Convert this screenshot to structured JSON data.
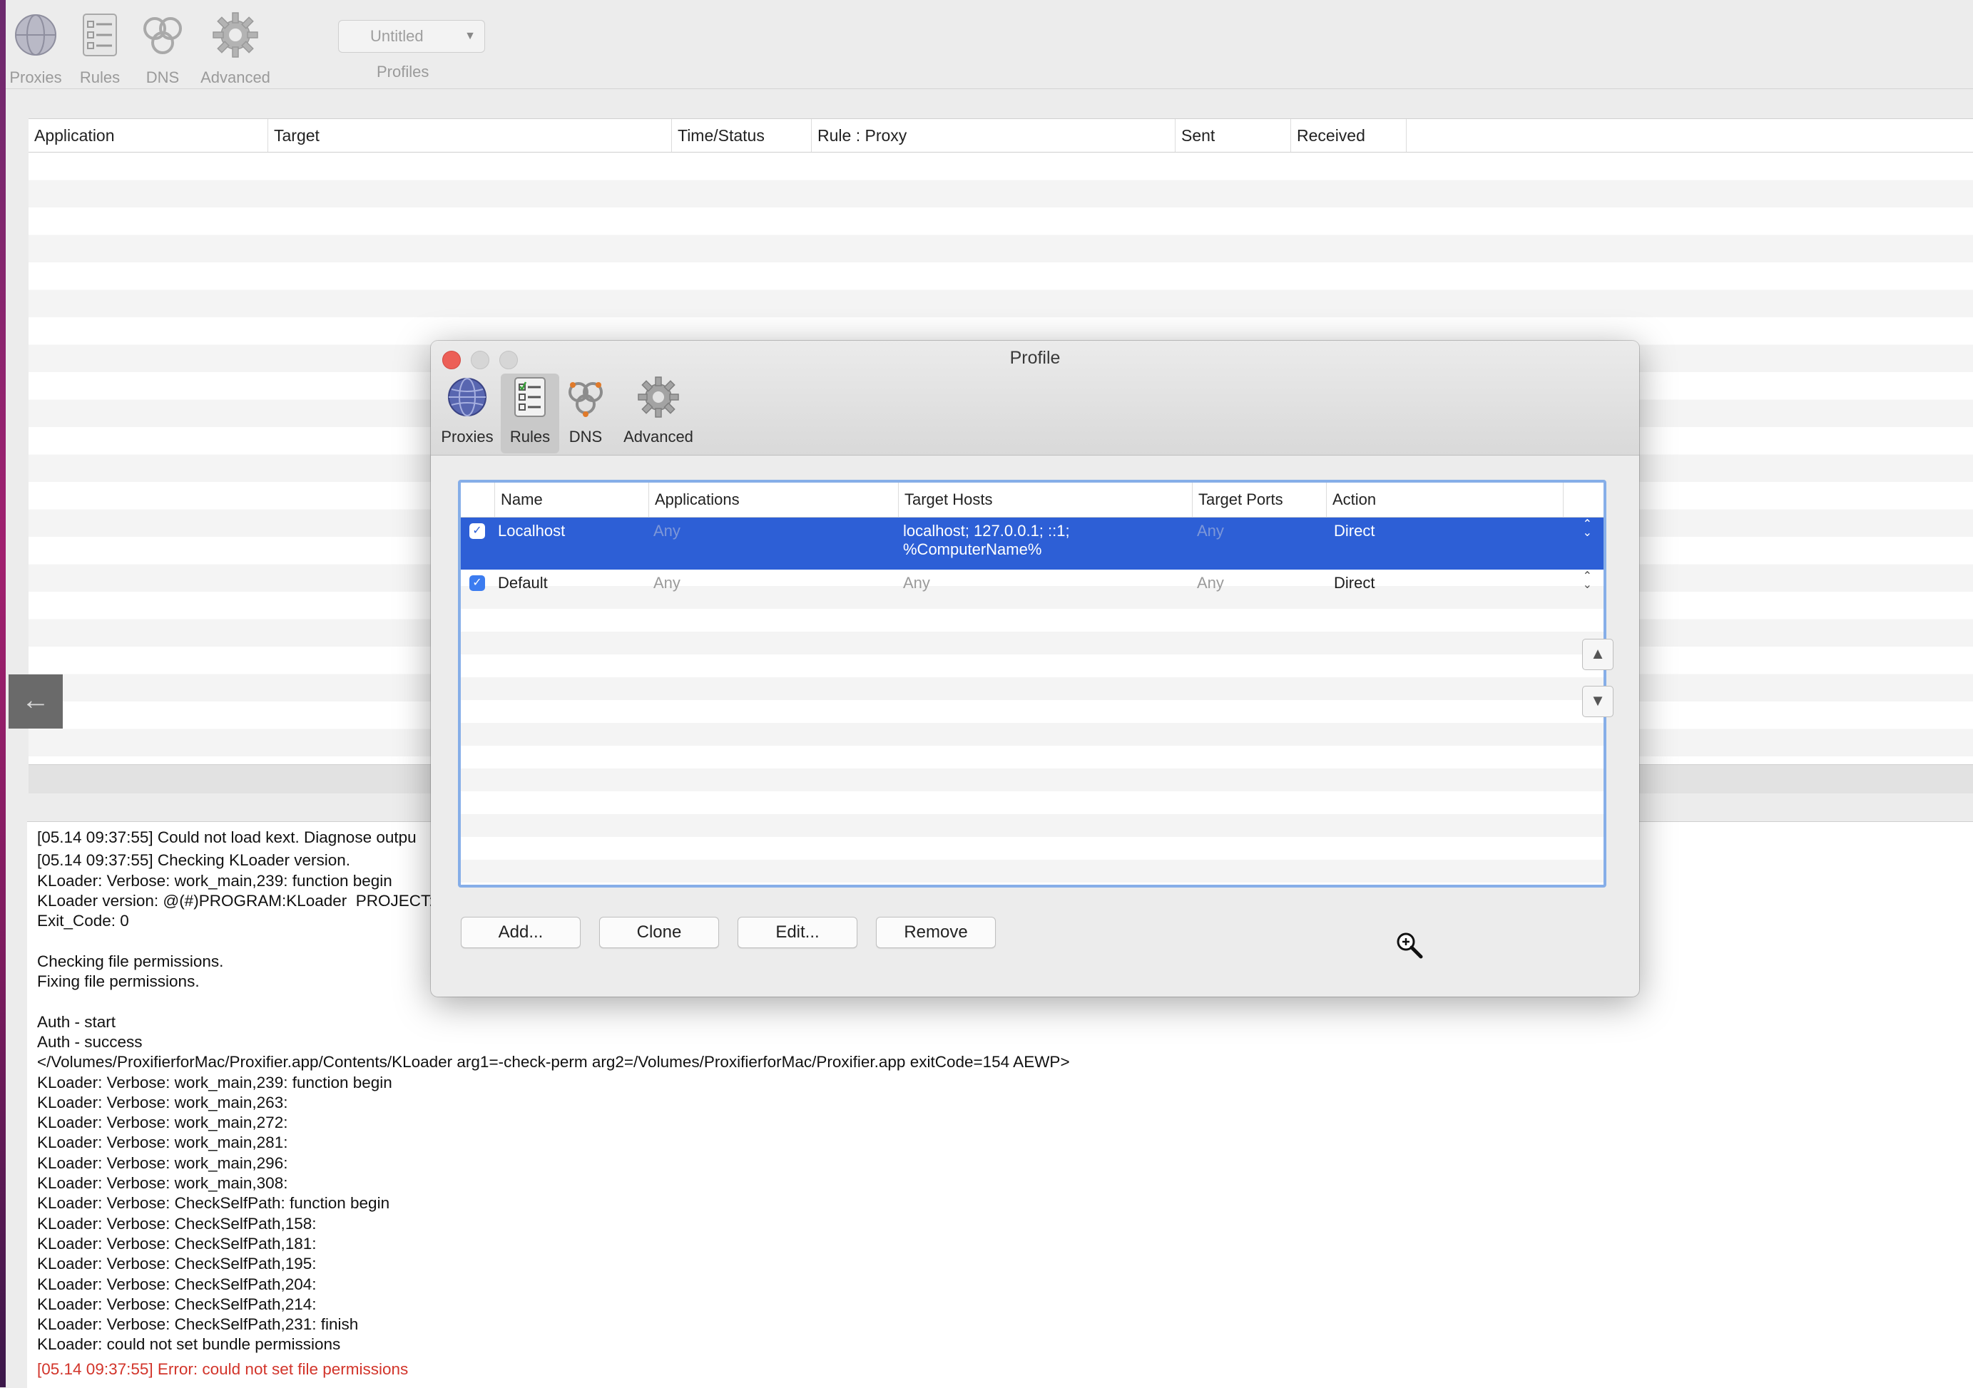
{
  "main_toolbar": {
    "items": [
      {
        "label": "Proxies",
        "icon": "globe-icon"
      },
      {
        "label": "Rules",
        "icon": "rules-list-icon"
      },
      {
        "label": "DNS",
        "icon": "dns-rings-icon"
      },
      {
        "label": "Advanced",
        "icon": "gear-icon"
      }
    ],
    "profile_value": "Untitled",
    "profiles_label": "Profiles"
  },
  "connections": {
    "columns": [
      "Application",
      "Target",
      "Time/Status",
      "Rule : Proxy",
      "Sent",
      "Received"
    ]
  },
  "log": {
    "lines": [
      "[05.14 09:37:55] Could not load kext. Diagnose outpu",
      "[05.14 09:37:55] Checking KLoader version.",
      "KLoader: Verbose: work_main,239: function begin",
      "KLoader version: @(#)PROGRAM:KLoader  PROJECT:",
      "Exit_Code: 0",
      "",
      "Checking file permissions.",
      "Fixing file permissions.",
      "",
      "Auth - start",
      "Auth - success",
      "</Volumes/ProxifierforMac/Proxifier.app/Contents/KLoader arg1=-check-perm arg2=/Volumes/ProxifierforMac/Proxifier.app exitCode=154 AEWP>",
      "KLoader: Verbose: work_main,239: function begin",
      "KLoader: Verbose: work_main,263:",
      "KLoader: Verbose: work_main,272:",
      "KLoader: Verbose: work_main,281:",
      "KLoader: Verbose: work_main,296:",
      "KLoader: Verbose: work_main,308:",
      "KLoader: Verbose: CheckSelfPath: function begin",
      "KLoader: Verbose: CheckSelfPath,158:",
      "KLoader: Verbose: CheckSelfPath,181:",
      "KLoader: Verbose: CheckSelfPath,195:",
      "KLoader: Verbose: CheckSelfPath,204:",
      "KLoader: Verbose: CheckSelfPath,214:",
      "KLoader: Verbose: CheckSelfPath,231: finish",
      "KLoader: could not set bundle permissions"
    ],
    "error_line": "[05.14 09:37:55] Error: could not set file permissions"
  },
  "dialog": {
    "title": "Profile",
    "tabs": [
      {
        "label": "Proxies",
        "icon": "globe-icon"
      },
      {
        "label": "Rules",
        "icon": "rules-list-icon"
      },
      {
        "label": "DNS",
        "icon": "dns-rings-icon"
      },
      {
        "label": "Advanced",
        "icon": "gear-icon"
      }
    ],
    "selected_tab": "Rules",
    "rules_columns": [
      "Name",
      "Applications",
      "Target Hosts",
      "Target Ports",
      "Action"
    ],
    "rules": [
      {
        "enabled": true,
        "name": "Localhost",
        "applications": "Any",
        "target_hosts_line1": "localhost; 127.0.0.1; ::1;",
        "target_hosts_line2": "%ComputerName%",
        "target_ports": "Any",
        "action": "Direct",
        "selected": true
      },
      {
        "enabled": true,
        "name": "Default",
        "applications": "Any",
        "target_hosts_line1": "Any",
        "target_hosts_line2": "",
        "target_ports": "Any",
        "action": "Direct",
        "selected": false
      }
    ],
    "buttons": {
      "add": "Add...",
      "clone": "Clone",
      "edit": "Edit...",
      "remove": "Remove"
    },
    "move_up": "▲",
    "move_down": "▼",
    "selection_color": "#2d5fd6",
    "focus_ring_color": "#86aee8"
  },
  "back_arrow": "←"
}
